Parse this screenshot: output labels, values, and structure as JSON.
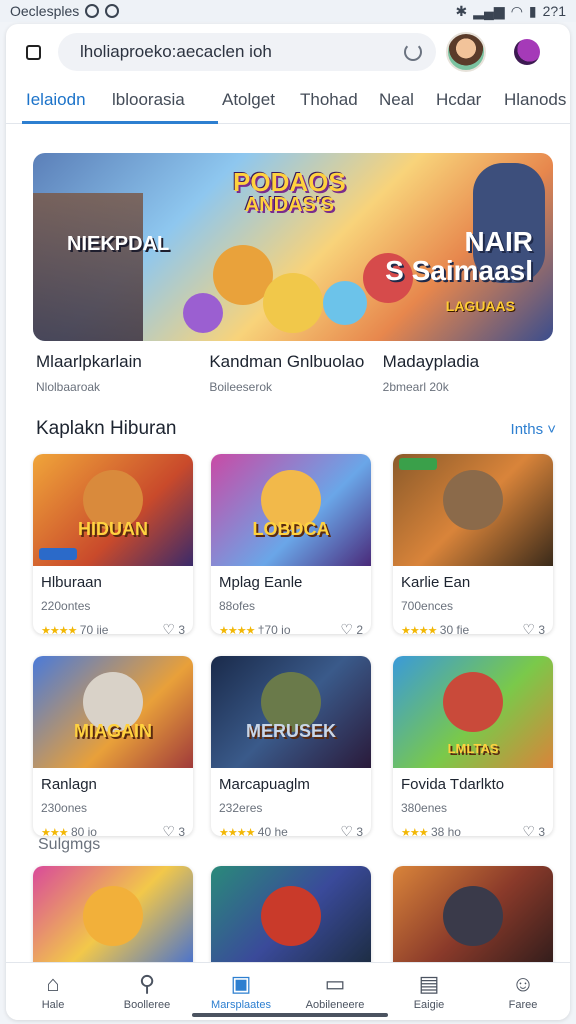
{
  "status": {
    "left": "Oeclesples",
    "time": "2?1"
  },
  "search": {
    "value": "lholiaproeko:aecaclen ioh"
  },
  "tabs": [
    {
      "label": "Ielaiodn"
    },
    {
      "label": "lbloorasia"
    },
    {
      "label": "Atolget"
    },
    {
      "label": "Thohad"
    },
    {
      "label": "Neal"
    },
    {
      "label": "Hcdar"
    },
    {
      "label": "Hlanods"
    }
  ],
  "hero": {
    "title_line1": "PODAOS",
    "title_line2": "ANDAS'S",
    "left_text": "NIEKPDAL",
    "right_line1": "NAIR",
    "right_line2": "S Saimaasl",
    "badge": "LAGUAAS"
  },
  "featured": [
    {
      "title": "Mlaarlpkarlain",
      "sub": "Nlolbaaroak"
    },
    {
      "title": "Kandman Gnlbuolao",
      "sub": "Boileeserok"
    },
    {
      "title": "Madaypladia",
      "sub": "2bmearl 20k"
    }
  ],
  "section": {
    "title": "Kaplakn Hiburan",
    "link": "Inths ˅"
  },
  "cards": [
    {
      "img_label": "HIDUAN",
      "title": "Hlburaan",
      "sub": "220ontes",
      "stars": "★★★★",
      "rating": "70 iie",
      "likes": "3"
    },
    {
      "img_label": "LOBDCA",
      "title": "Mplag Eanle",
      "sub": "88ofes",
      "stars": "★★★★",
      "rating": "†70 io",
      "likes": "2"
    },
    {
      "img_label": "",
      "title": "Karlie Ean",
      "sub": "700ences",
      "stars": "★★★★",
      "rating": "30 fie",
      "likes": "3"
    },
    {
      "img_label": "MIAGAIN",
      "title": "Ranlagn",
      "sub": "230ones",
      "stars": "★★★",
      "rating": "80 io",
      "likes": "3"
    },
    {
      "img_label": "MERUSEK",
      "title": "Marcapuaglm",
      "sub": "232eres",
      "stars": "★★★★",
      "rating": "40 he",
      "likes": "3"
    },
    {
      "img_label": "LMLTAS",
      "title": "Fovida Tdarlkto",
      "sub": "380enes",
      "stars": "★★★",
      "rating": "38 ho",
      "likes": "3"
    }
  ],
  "subhead": "Sulgmgs",
  "nav": [
    {
      "label": "Hale",
      "icon": "home-icon"
    },
    {
      "label": "Boolleree",
      "icon": "search-icon"
    },
    {
      "label": "Marsplaates",
      "icon": "store-icon"
    },
    {
      "label": "Aobileneere",
      "icon": "book-icon"
    },
    {
      "label": "Eaigie",
      "icon": "gallery-icon"
    },
    {
      "label": "Faree",
      "icon": "profile-icon"
    }
  ],
  "colors": {
    "accent": "#2d7fd0",
    "stars": "#f2b705"
  }
}
